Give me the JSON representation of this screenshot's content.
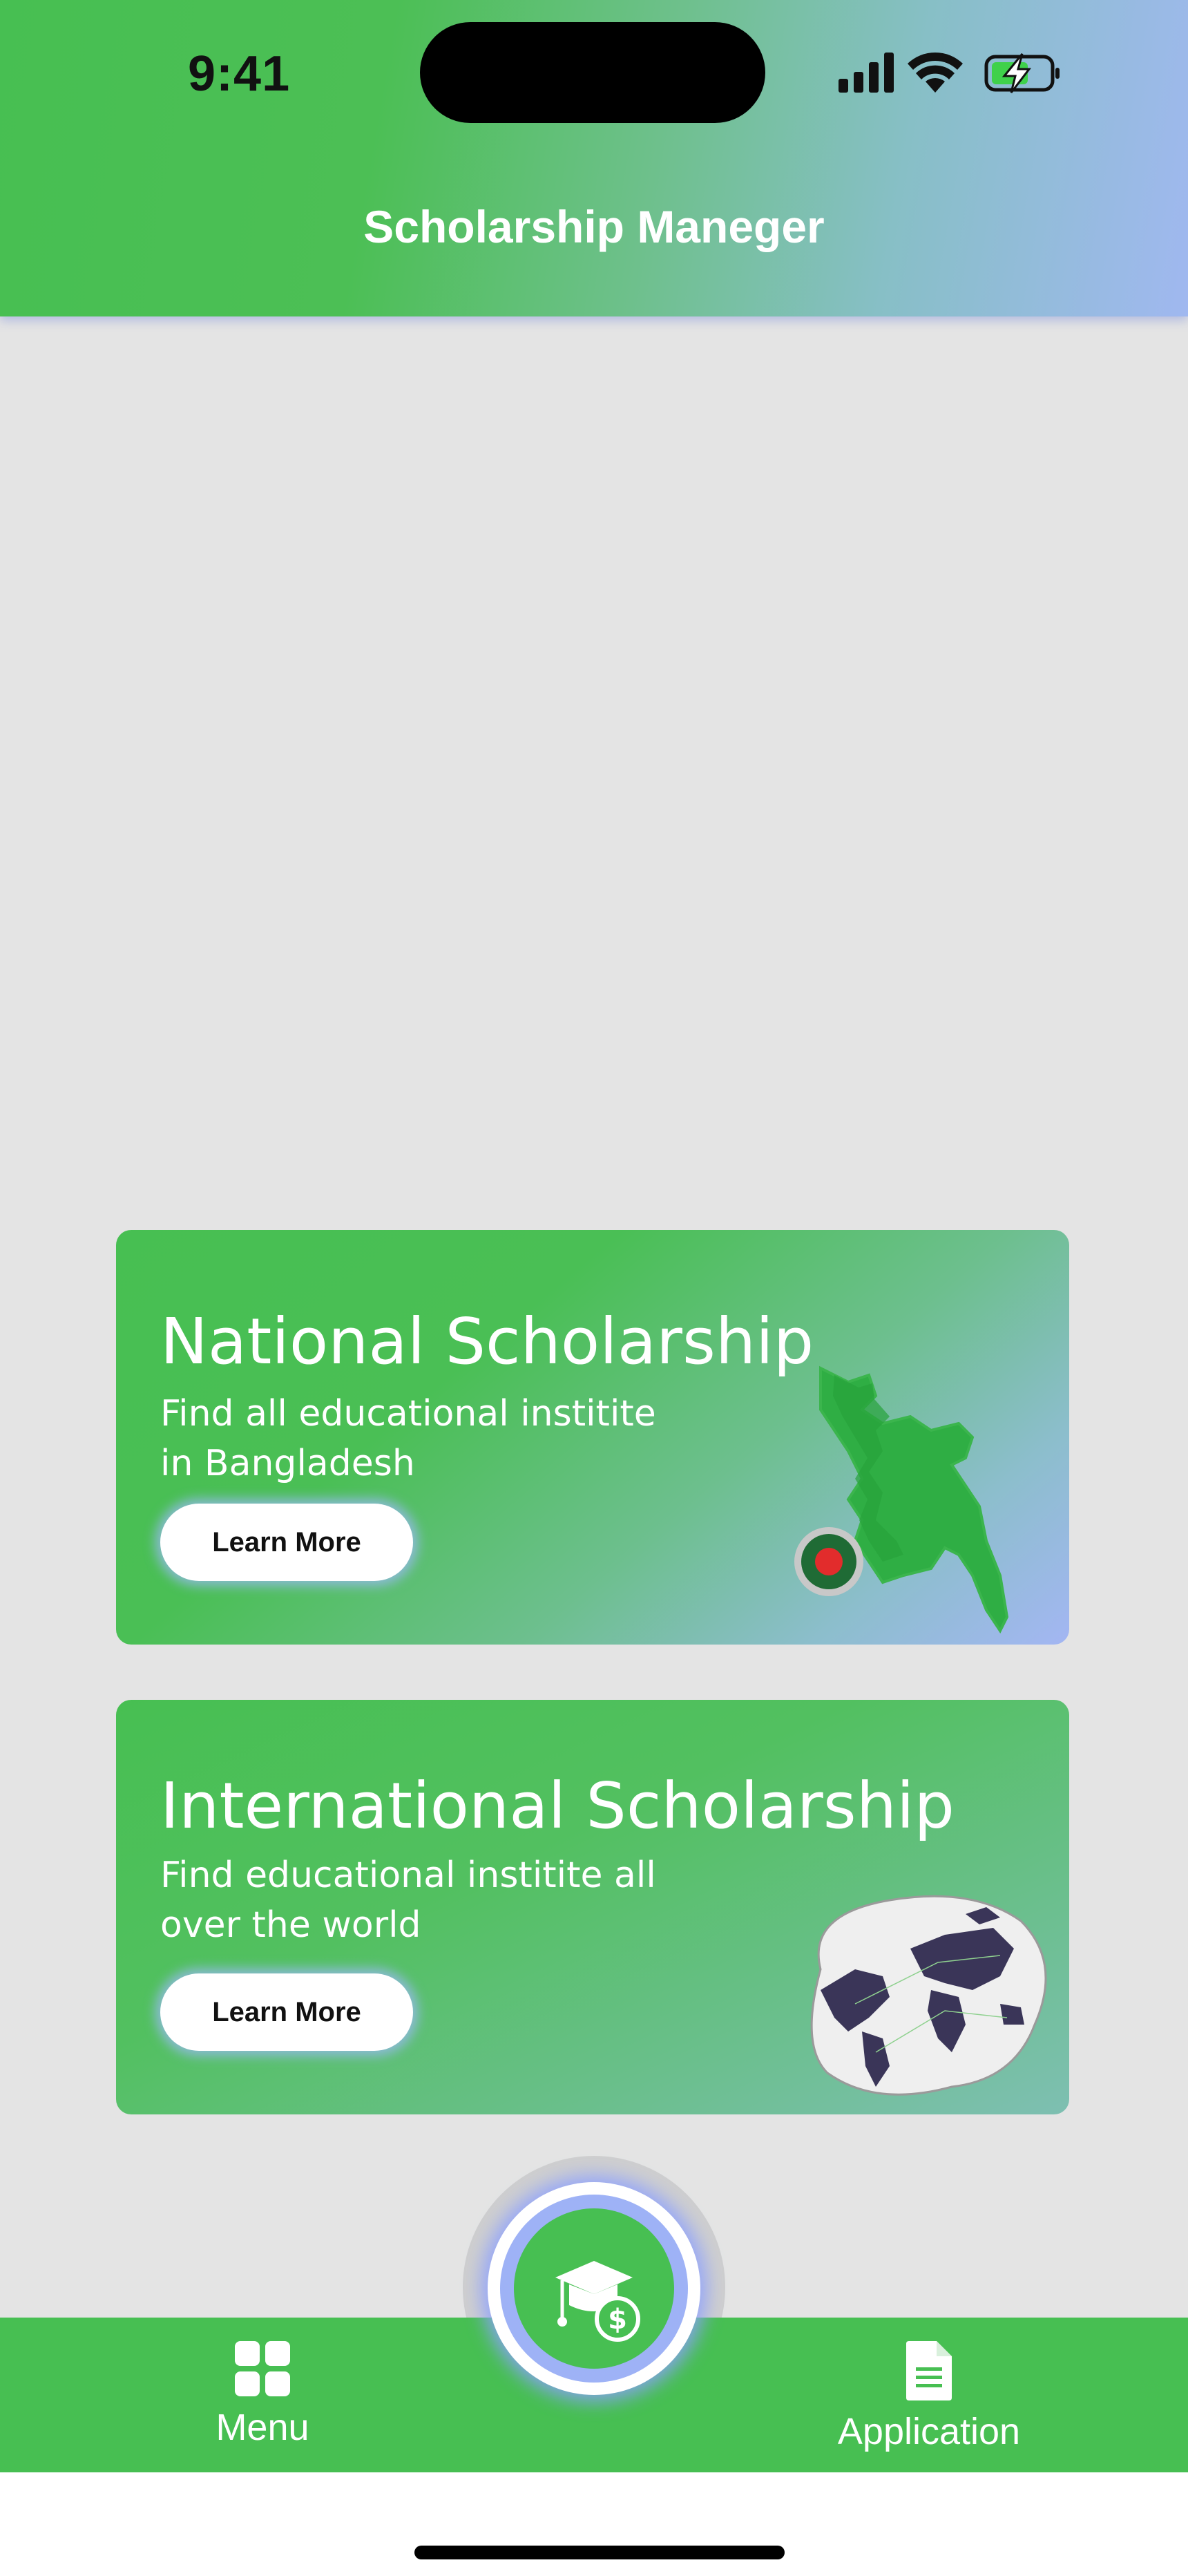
{
  "status_bar": {
    "time": "9:41"
  },
  "header": {
    "title": "Scholarship Maneger"
  },
  "cards": [
    {
      "title": "National Scholarship",
      "subtitle": "Find all educational institite in Bangladesh",
      "button": "Learn More",
      "illustration": "bangladesh-map"
    },
    {
      "title": "International Scholarship",
      "subtitle": "Find educational institite all over the world",
      "button": "Learn More",
      "illustration": "world-map"
    }
  ],
  "bottom_nav": {
    "items": [
      {
        "label": "Menu",
        "icon": "grid-icon"
      },
      {
        "label": "Application",
        "icon": "document-icon"
      }
    ],
    "center_icon": "graduation-cap-dollar-icon"
  },
  "colors": {
    "primary_green": "#47bf52",
    "accent_blue": "#a0b8f0",
    "background": "#e4e4e4"
  }
}
